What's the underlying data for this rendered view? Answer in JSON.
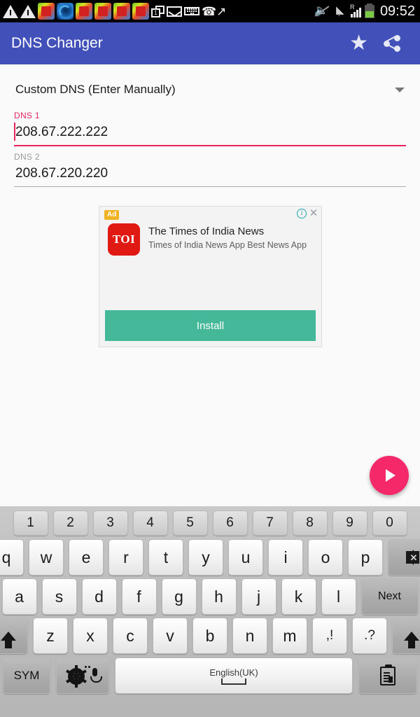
{
  "status_bar": {
    "time": "09:52",
    "roaming_label": "R",
    "tab_count": "1",
    "icons": [
      "warning-triangle-icon",
      "warning-triangle-icon",
      "app-notification-icon",
      "app-spiral-icon",
      "app-notification-icon",
      "app-notification-icon",
      "app-notification-icon",
      "app-notification-icon",
      "tabs-icon",
      "mail-icon",
      "keyboard-icon",
      "call-forward-icon",
      "mute-icon",
      "wifi-icon",
      "signal-icon",
      "battery-icon"
    ]
  },
  "app_bar": {
    "title": "DNS Changer",
    "favorite_icon": "star-icon",
    "share_icon": "share-icon",
    "background": "#4250ba"
  },
  "main": {
    "mode_spinner": {
      "selected": "Custom DNS (Enter Manually)",
      "caret_icon": "chevron-down-icon"
    },
    "dns1": {
      "label": "DNS 1",
      "value": "208.67.222.222",
      "placeholder": "DNS 1",
      "accent": "#e8245f",
      "focused": true
    },
    "dns2": {
      "label": "DNS 2",
      "value": "208.67.220.220",
      "placeholder": "DNS 2",
      "focused": false
    },
    "start_button": {
      "icon": "play-icon",
      "color": "#f5286a"
    }
  },
  "ad": {
    "badge": "Ad",
    "info_icon": "info-icon",
    "close_icon": "close-icon",
    "logo_text": "TOI",
    "logo_color": "#e01a13",
    "title": "The Times of India News",
    "subtitle": "Times of India News App Best News App",
    "cta": "Install",
    "cta_color": "#46b89a"
  },
  "keyboard": {
    "row_numbers": [
      "1",
      "2",
      "3",
      "4",
      "5",
      "6",
      "7",
      "8",
      "9",
      "0"
    ],
    "row_top": [
      "q",
      "w",
      "e",
      "r",
      "t",
      "y",
      "u",
      "i",
      "o",
      "p"
    ],
    "backspace_icon": "backspace-icon",
    "row_home": [
      "a",
      "s",
      "d",
      "f",
      "g",
      "h",
      "j",
      "k",
      "l"
    ],
    "next_label": "Next",
    "row_bottom": [
      "z",
      "x",
      "c",
      "v",
      "b",
      "n",
      "m",
      ",!",
      ".?"
    ],
    "shift_left_icon": "shift-up-icon",
    "shift_right_icon": "shift-up-icon",
    "sym_label": "SYM",
    "settings_icon": "gear-mic-icon",
    "space_label": "English(UK)",
    "space_glyph_icon": "space-bar-icon",
    "clipboard_icon": "clipboard-icon"
  }
}
